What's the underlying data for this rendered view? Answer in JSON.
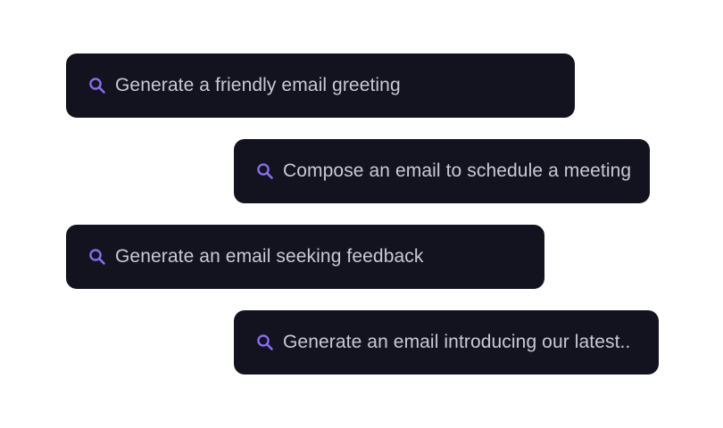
{
  "accent_color": "#8a6cf0",
  "chip_background": "#12131e",
  "text_color": "#c9c9d3",
  "prompts": [
    {
      "icon": "search-icon",
      "label": "Generate a friendly email greeting"
    },
    {
      "icon": "search-icon",
      "label": "Compose an email to schedule a meeting"
    },
    {
      "icon": "search-icon",
      "label": "Generate an email seeking feedback"
    },
    {
      "icon": "search-icon",
      "label": "Generate an email introducing our latest.."
    }
  ]
}
